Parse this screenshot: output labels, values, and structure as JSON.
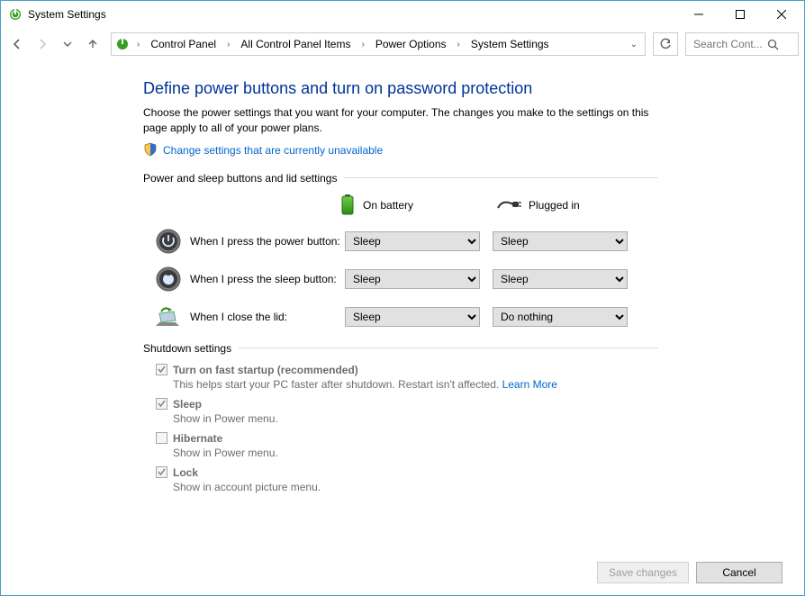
{
  "window": {
    "title": "System Settings"
  },
  "breadcrumb": {
    "items": [
      "Control Panel",
      "All Control Panel Items",
      "Power Options",
      "System Settings"
    ]
  },
  "search": {
    "placeholder": "Search Cont..."
  },
  "page": {
    "title": "Define power buttons and turn on password protection",
    "description": "Choose the power settings that you want for your computer. The changes you make to the settings on this page apply to all of your power plans.",
    "admin_link": "Change settings that are currently unavailable"
  },
  "buttons_section": {
    "heading": "Power and sleep buttons and lid settings",
    "col_battery": "On battery",
    "col_plugged": "Plugged in",
    "rows": [
      {
        "label": "When I press the power button:",
        "battery": "Sleep",
        "plugged": "Sleep"
      },
      {
        "label": "When I press the sleep button:",
        "battery": "Sleep",
        "plugged": "Sleep"
      },
      {
        "label": "When I close the lid:",
        "battery": "Sleep",
        "plugged": "Do nothing"
      }
    ]
  },
  "shutdown_section": {
    "heading": "Shutdown settings",
    "items": [
      {
        "label": "Turn on fast startup (recommended)",
        "bold": true,
        "checked": true,
        "sub": "This helps start your PC faster after shutdown. Restart isn't affected. ",
        "link": "Learn More"
      },
      {
        "label": "Sleep",
        "bold": true,
        "checked": true,
        "sub": "Show in Power menu."
      },
      {
        "label": "Hibernate",
        "bold": true,
        "checked": false,
        "sub": "Show in Power menu."
      },
      {
        "label": "Lock",
        "bold": true,
        "checked": true,
        "sub": "Show in account picture menu."
      }
    ]
  },
  "footer": {
    "save": "Save changes",
    "cancel": "Cancel"
  }
}
